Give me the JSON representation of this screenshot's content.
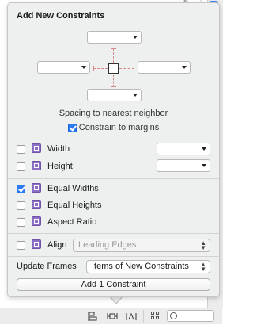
{
  "background": {
    "tag_text": "Drawing"
  },
  "popover": {
    "title": "Add New Constraints",
    "spacing_label": "Spacing to nearest neighbor",
    "constrain_to_margins": {
      "label": "Constrain to margins",
      "checked": true
    },
    "rows": [
      {
        "label": "Width",
        "checked": false,
        "icon": "width-icon"
      },
      {
        "label": "Height",
        "checked": false,
        "icon": "height-icon"
      },
      {
        "label": "Equal Widths",
        "checked": true,
        "icon": "equal-widths-icon"
      },
      {
        "label": "Equal Heights",
        "checked": false,
        "icon": "equal-heights-icon"
      },
      {
        "label": "Aspect Ratio",
        "checked": false,
        "icon": "aspect-ratio-icon"
      }
    ],
    "align": {
      "label": "Align",
      "checked": false,
      "value": "Leading Edges"
    },
    "update_frames": {
      "label": "Update Frames",
      "value": "Items of New Constraints"
    },
    "add_button": "Add 1 Constraint"
  },
  "colors": {
    "accent": "#2a7bf5",
    "icon_purple": "#8b6fc4",
    "strut": "#d78a8a"
  },
  "toolbar": {
    "icons": [
      "align-icon",
      "pin-icon",
      "resolve-issues-icon",
      "grid-icon",
      "scope-icon"
    ]
  }
}
